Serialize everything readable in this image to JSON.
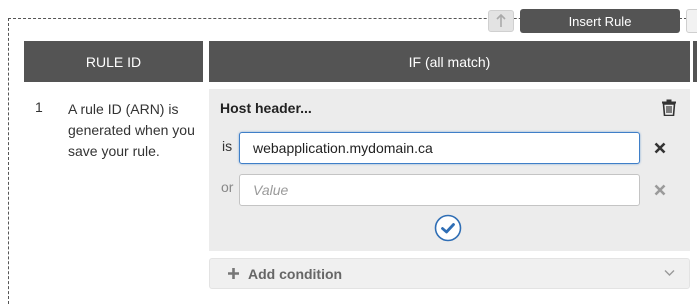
{
  "toolbar": {
    "insert_rule_label": "Insert Rule",
    "move_up_icon": "arrow-up-icon"
  },
  "table": {
    "headers": {
      "rule_id": "RULE ID",
      "if": "IF (all match)"
    }
  },
  "rule": {
    "number": "1",
    "id_text": "A rule ID (ARN) is generated when you save your rule."
  },
  "condition": {
    "title": "Host header...",
    "operator_is": "is",
    "operator_or": "or",
    "host_value": "webapplication.mydomain.ca",
    "value_placeholder": "Value",
    "icons": [
      "trash-icon",
      "close-icon",
      "checkmark-icon"
    ]
  },
  "add_condition": {
    "label": "Add condition",
    "icons": [
      "plus-icon",
      "chevron-down-icon"
    ]
  },
  "colors": {
    "header_bg": "#545454",
    "panel_bg": "#ececec",
    "focus_border": "#3f7fc8",
    "confirm_blue": "#2f6eb5"
  }
}
